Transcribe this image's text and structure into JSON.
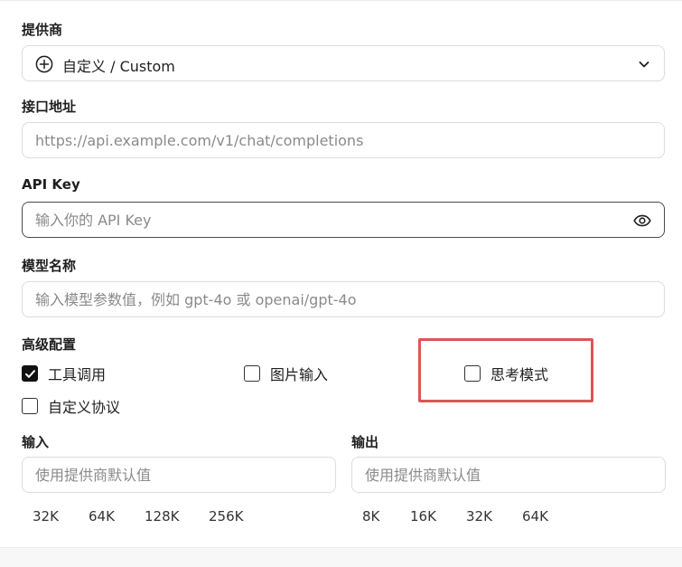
{
  "provider": {
    "label": "提供商",
    "selected": "自定义 / Custom"
  },
  "endpoint": {
    "label": "接口地址",
    "placeholder": "https://api.example.com/v1/chat/completions"
  },
  "api_key": {
    "label": "API Key",
    "placeholder": "输入你的 API Key"
  },
  "model": {
    "label": "模型名称",
    "placeholder": "输入模型参数值，例如 gpt-4o 或 openai/gpt-4o"
  },
  "advanced": {
    "label": "高级配置",
    "options": [
      {
        "label": "工具调用",
        "checked": true
      },
      {
        "label": "图片输入",
        "checked": false
      },
      {
        "label": "思考模式",
        "checked": false
      },
      {
        "label": "自定义协议",
        "checked": false
      }
    ]
  },
  "input_limit": {
    "label": "输入",
    "placeholder": "使用提供商默认值",
    "presets": [
      "32K",
      "64K",
      "128K",
      "256K"
    ]
  },
  "output_limit": {
    "label": "输出",
    "placeholder": "使用提供商默认值",
    "presets": [
      "8K",
      "16K",
      "32K",
      "64K"
    ]
  },
  "colors": {
    "highlight": "#e15454",
    "border": "#dcdcdc",
    "checked": "#111111"
  }
}
